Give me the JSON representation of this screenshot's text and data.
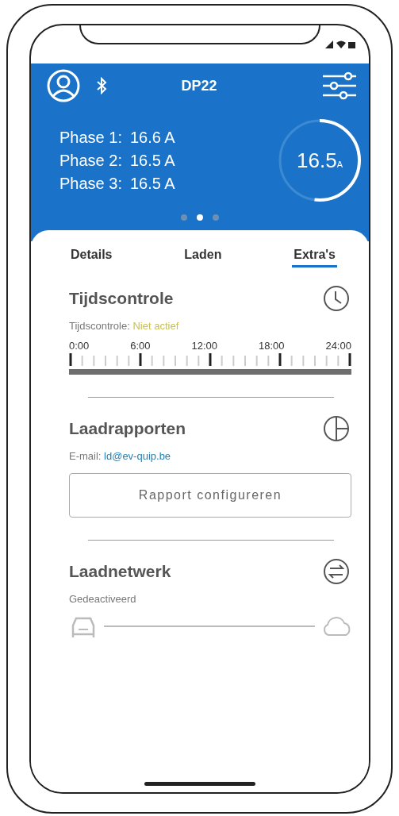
{
  "header": {
    "title": "DP22"
  },
  "phases": [
    {
      "label": "Phase 1:",
      "value": "16.6 A"
    },
    {
      "label": "Phase 2:",
      "value": "16.5 A"
    },
    {
      "label": "Phase 3:",
      "value": "16.5 A"
    }
  ],
  "gauge": {
    "value": "16.5",
    "unit": "A",
    "level": 0.52
  },
  "pager": [
    {
      "selected": false
    },
    {
      "selected": true
    },
    {
      "selected": false
    }
  ],
  "tabs": [
    {
      "label": "Details",
      "selected": false
    },
    {
      "label": "Laden",
      "selected": false
    },
    {
      "label": "Extra's",
      "selected": true
    }
  ],
  "time_control": {
    "title": "Tijdscontrole",
    "status_label": "Tijdscontrole:",
    "status_value": "Niet actief",
    "hours": [
      "0:00",
      "6:00",
      "12:00",
      "18:00",
      "24:00"
    ]
  },
  "reports": {
    "title": "Laadrapporten",
    "email_label": "E-mail:",
    "email": "ld@ev-quip.be",
    "button": "Rapport configureren"
  },
  "network": {
    "title": "Laadnetwerk",
    "status": "Gedeactiveerd"
  }
}
